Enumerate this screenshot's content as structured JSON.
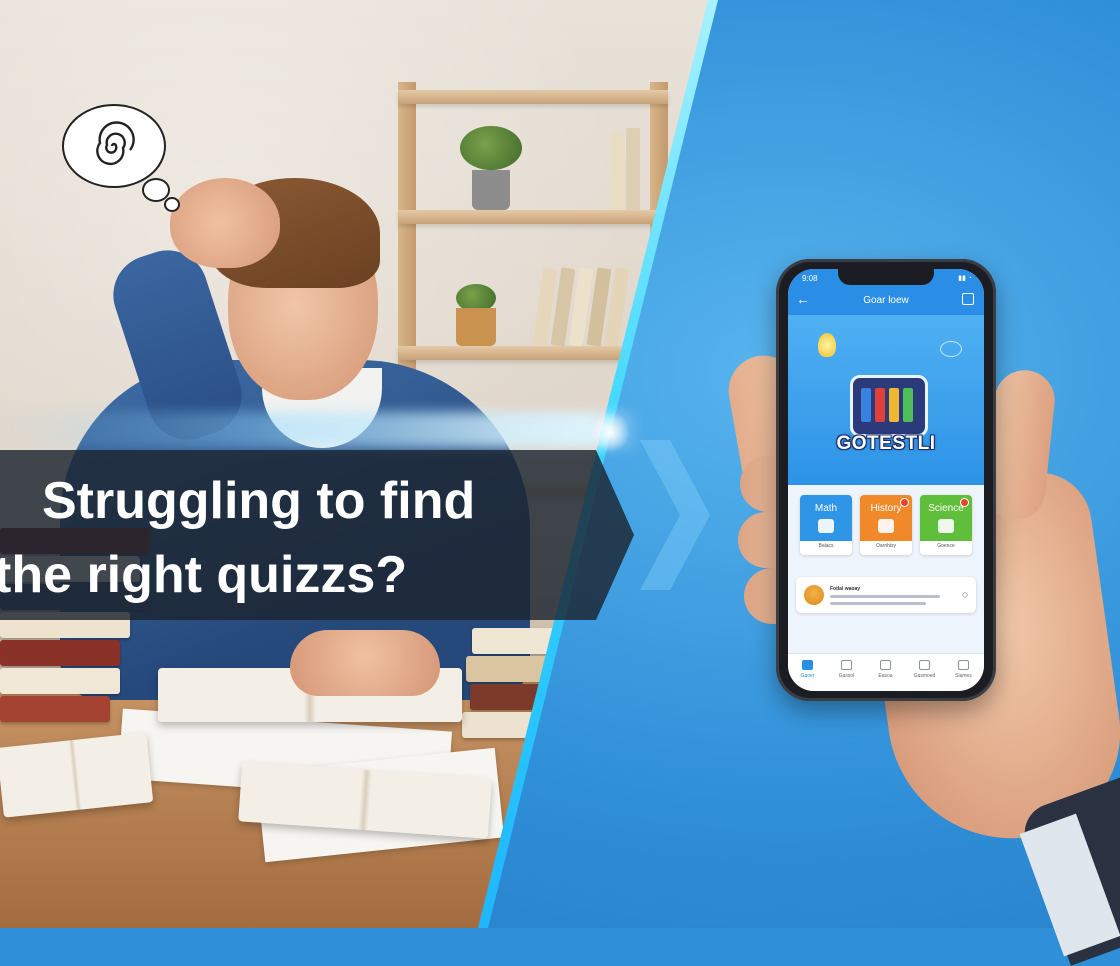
{
  "banner": {
    "line1": "Struggling to find",
    "line2": "the right quizzs?"
  },
  "thought_bubble": {
    "icon": "spiral-icon"
  },
  "phone": {
    "status_time": "9:08",
    "header_title": "Goar loew",
    "logo_text": "GOTESTLI",
    "categories": [
      {
        "title": "Math",
        "sub": "Balacs",
        "color": "#2f95e6"
      },
      {
        "title": "History",
        "sub": "Oarnhisy",
        "color": "#f0892a"
      },
      {
        "title": "Science",
        "sub": "Goence",
        "color": "#5fbf3b"
      }
    ],
    "card": {
      "title": "Fotlal waoay"
    },
    "tabs": [
      "Gaoer",
      "Gassol",
      "Easoa",
      "Gasmoed",
      "Slames"
    ]
  },
  "colors": {
    "accent": "#2a8de6",
    "divider": "#36d4ff",
    "banner_bg": "#1c2430"
  }
}
